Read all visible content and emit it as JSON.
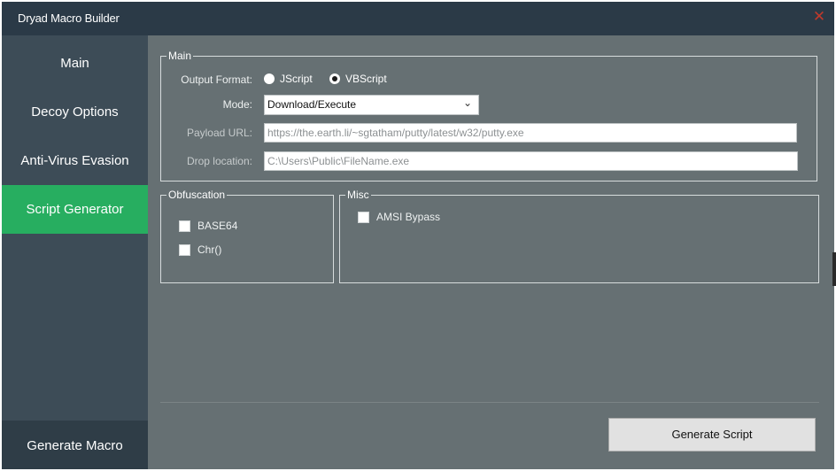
{
  "window": {
    "title": "Dryad Macro Builder",
    "close_glyph": "✕"
  },
  "sidebar": {
    "items": [
      {
        "label": "Main",
        "active": false
      },
      {
        "label": "Decoy Options",
        "active": false
      },
      {
        "label": "Anti-Virus Evasion",
        "active": false
      },
      {
        "label": "Script Generator",
        "active": true
      }
    ],
    "bottom_label": "Generate Macro"
  },
  "main_group": {
    "legend": "Main",
    "output_format_label": "Output Format:",
    "format_options": [
      {
        "label": "JScript",
        "selected": false
      },
      {
        "label": "VBScript",
        "selected": true
      }
    ],
    "mode_label": "Mode:",
    "mode_value": "Download/Execute",
    "payload_label": "Payload URL:",
    "payload_value": "https://the.earth.li/~sgtatham/putty/latest/w32/putty.exe",
    "drop_label": "Drop location:",
    "drop_value": "C:\\Users\\Public\\FileName.exe"
  },
  "obfuscation_group": {
    "legend": "Obfuscation",
    "options": [
      {
        "label": "BASE64",
        "checked": false
      },
      {
        "label": "Chr()",
        "checked": false
      }
    ]
  },
  "misc_group": {
    "legend": "Misc",
    "options": [
      {
        "label": "AMSI Bypass",
        "checked": false
      }
    ]
  },
  "generate_button_label": "Generate Script",
  "colors": {
    "titlebar": "#2b3a47",
    "sidebar": "#3d4c57",
    "active_nav": "#27ae60",
    "panel": "#667073",
    "close": "#c0392b"
  }
}
